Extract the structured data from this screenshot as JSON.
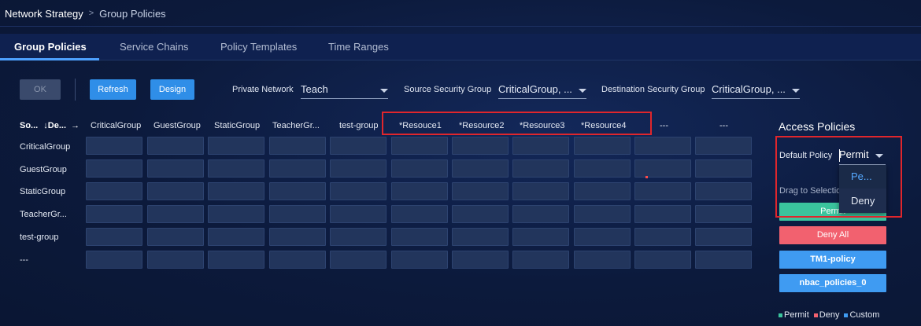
{
  "breadcrumb": {
    "root": "Network Strategy",
    "separator": ">",
    "current": "Group Policies"
  },
  "tabs": [
    "Group Policies",
    "Service Chains",
    "Policy Templates",
    "Time Ranges"
  ],
  "toolbar": {
    "ok": "OK",
    "refresh": "Refresh",
    "design": "Design"
  },
  "filters": {
    "private_network": {
      "label": "Private Network",
      "value": "Teach"
    },
    "source_group": {
      "label": "Source Security Group",
      "value": "CriticalGroup, ..."
    },
    "dest_group": {
      "label": "Destination Security Group",
      "value": "CriticalGroup, ..."
    }
  },
  "matrix": {
    "corner_label": "So...",
    "corner_arrow_in": "↓",
    "corner_dest": "De...",
    "corner_arrow_out": "→",
    "columns": [
      "CriticalGroup",
      "GuestGroup",
      "StaticGroup",
      "TeacherGr...",
      "test-group",
      "*Resouce1",
      "*Resource2",
      "*Resource3",
      "*Resource4",
      "---",
      "---"
    ],
    "rows": [
      "CriticalGroup",
      "GuestGroup",
      "StaticGroup",
      "TeacherGr...",
      "test-group",
      "---"
    ]
  },
  "access_panel": {
    "title": "Access Policies",
    "default_policy_label": "Default Policy",
    "default_policy_value": "Permit",
    "dropdown_options": [
      "Pe...",
      "Deny"
    ],
    "drag_hint": "Drag to Selection",
    "policies": {
      "permit": "Permit",
      "deny": "Deny All",
      "tm1": "TM1-policy",
      "nbac": "nbac_policies_0"
    },
    "legend": [
      "Permit",
      "Deny",
      "Custom"
    ]
  },
  "colors": {
    "permit": "#3ac49d",
    "deny": "#f2616f",
    "custom": "#3f9bf2",
    "accent": "#2f8ee8",
    "highlight": "#e0262c"
  }
}
